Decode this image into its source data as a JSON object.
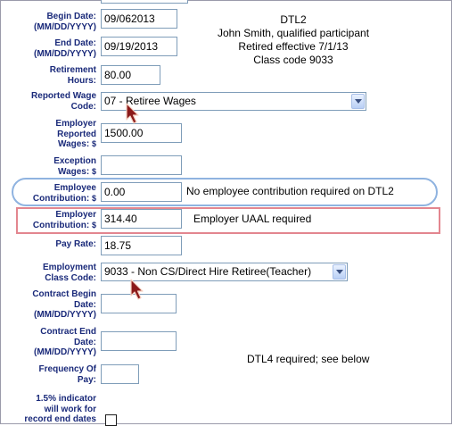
{
  "form": {
    "begin_date": {
      "label": "Begin Date:",
      "unit": "(MM/DD/YYYY)",
      "value": "09/062013"
    },
    "end_date": {
      "label": "End Date:",
      "unit": "(MM/DD/YYYY)",
      "value": "09/19/2013"
    },
    "retirement_hours": {
      "label_line1": "Retirement",
      "label_line2": "Hours:",
      "value": "80.00"
    },
    "reported_wage_code": {
      "label_line1": "Reported Wage",
      "label_line2": "Code:",
      "selected": "07 -  Retiree Wages"
    },
    "employer_reported_wages": {
      "label_line1": "Employer",
      "label_line2": "Reported",
      "label_line3": "Wages:",
      "unit": "$",
      "value": "1500.00"
    },
    "exception_wages": {
      "label_line1": "Exception",
      "label_line2": "Wages:",
      "unit": "$",
      "value": ""
    },
    "employee_contribution": {
      "label_line1": "Employee",
      "label_line2": "Contribution:",
      "unit": "$",
      "value": "0.00"
    },
    "employer_contribution": {
      "label_line1": "Employer",
      "label_line2": "Contribution:",
      "unit": "$",
      "value": "314.40"
    },
    "pay_rate": {
      "label": "Pay Rate:",
      "value": "18.75"
    },
    "employment_class_code": {
      "label_line1": "Employment",
      "label_line2": "Class Code:",
      "selected": "9033 - Non CS/Direct Hire Retiree(Teacher)"
    },
    "contract_begin_date": {
      "label_line1": "Contract Begin",
      "label_line2": "Date:",
      "unit": "(MM/DD/YYYY)",
      "value": ""
    },
    "contract_end_date": {
      "label_line1": "Contract End",
      "label_line2": "Date:",
      "unit": "(MM/DD/YYYY)",
      "value": ""
    },
    "frequency_of_pay": {
      "label_line1": "Frequency Of",
      "label_line2": "Pay:",
      "value": ""
    },
    "indicator": {
      "label_line1": "1.5% indicator",
      "label_line2": "will work for",
      "label_line3": "record end dates",
      "checked": false
    }
  },
  "annotations": {
    "dtl2_lines": [
      "DTL2",
      "John Smith, qualified participant",
      "Retired effective 7/1/13",
      "Class code 9033"
    ],
    "employee_note": "No employee contribution required on DTL2",
    "employer_note": "Employer UAAL required",
    "dtl4_note": "DTL4 required; see below",
    "employee_highlight_color": "#8fb3e0",
    "employer_highlight_color": "#e3868f"
  },
  "colors": {
    "label_text": "#1a2a7a",
    "field_border": "#7f9db9"
  }
}
